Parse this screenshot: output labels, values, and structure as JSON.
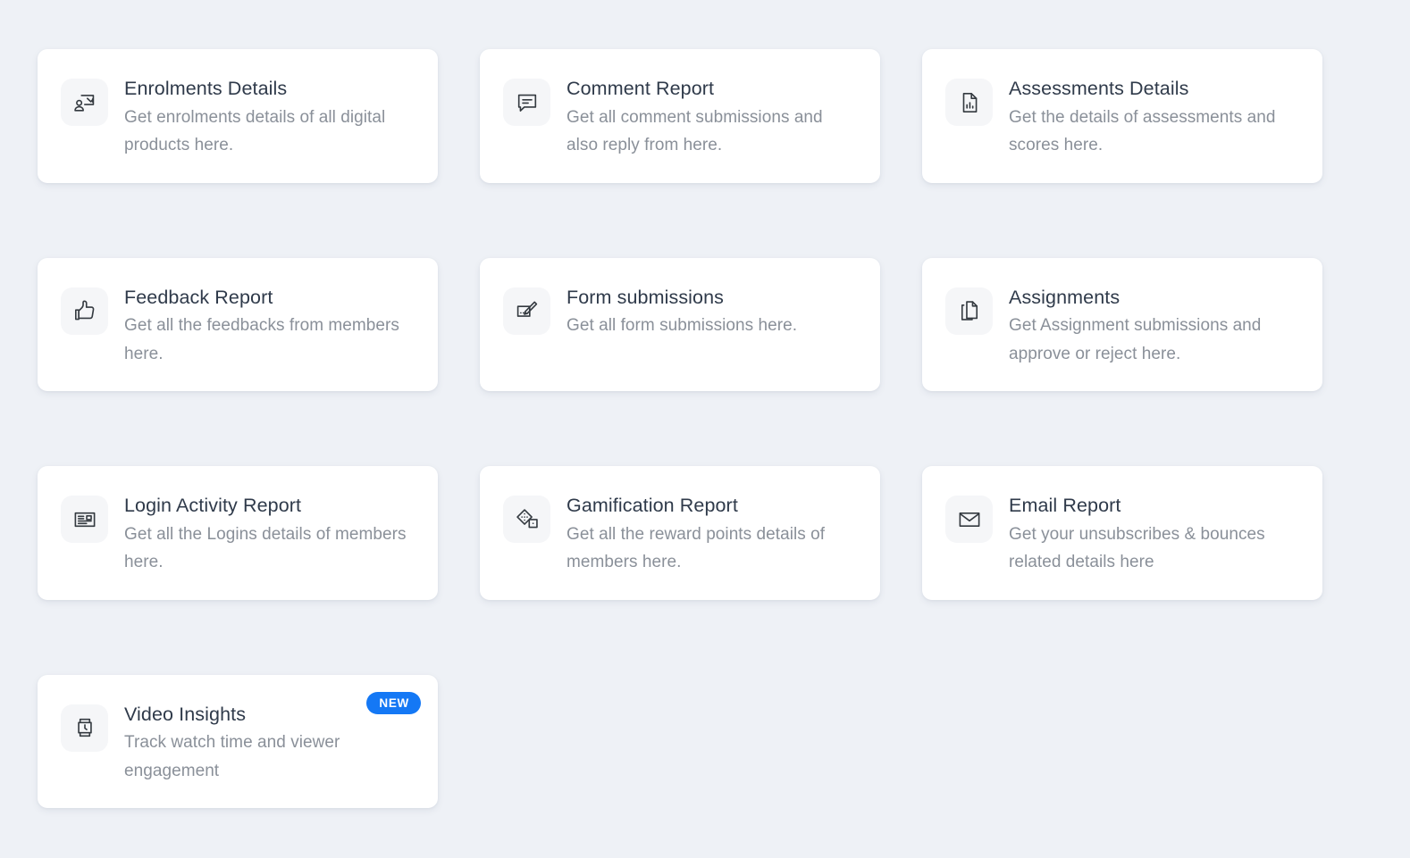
{
  "theme": {
    "page_background": "#eef1f6",
    "card_background": "#ffffff",
    "icon_tile_background": "#f5f6f8",
    "title_color": "#2f3a4a",
    "description_color": "#8a9099",
    "badge_color": "#1478f5",
    "badge_text_color": "#ffffff",
    "icon_stroke_color": "#343a40"
  },
  "cards": [
    {
      "id": "enrolments-details",
      "title": "Enrolments Details",
      "description": "Get enrolments details of all digital products here.",
      "icon": "presentation-user-icon",
      "badge": null
    },
    {
      "id": "comment-report",
      "title": "Comment Report",
      "description": "Get all comment submissions and also reply from here.",
      "icon": "comment-bubble-icon",
      "badge": null
    },
    {
      "id": "assessments-details",
      "title": "Assessments Details",
      "description": "Get the details of assessments and scores here.",
      "icon": "document-chart-icon",
      "badge": null
    },
    {
      "id": "feedback-report",
      "title": "Feedback Report",
      "description": "Get all the feedbacks from members here.",
      "icon": "thumbs-up-icon",
      "badge": null
    },
    {
      "id": "form-submissions",
      "title": "Form submissions",
      "description": "Get all form submissions here.",
      "icon": "form-pencil-icon",
      "badge": null
    },
    {
      "id": "assignments",
      "title": "Assignments",
      "description": "Get Assignment submissions and approve or reject here.",
      "icon": "copy-documents-icon",
      "badge": null
    },
    {
      "id": "login-activity-report",
      "title": "Login Activity Report",
      "description": "Get all the Logins details of members here.",
      "icon": "id-card-icon",
      "badge": null
    },
    {
      "id": "gamification-report",
      "title": "Gamification Report",
      "description": "Get all the reward points details of members here.",
      "icon": "dice-icon",
      "badge": null
    },
    {
      "id": "email-report",
      "title": "Email Report",
      "description": "Get your unsubscribes & bounces related details here",
      "icon": "envelope-icon",
      "badge": null
    },
    {
      "id": "video-insights",
      "title": "Video Insights",
      "description": "Track watch time and viewer engagement",
      "icon": "smartwatch-icon",
      "badge": "NEW"
    }
  ]
}
